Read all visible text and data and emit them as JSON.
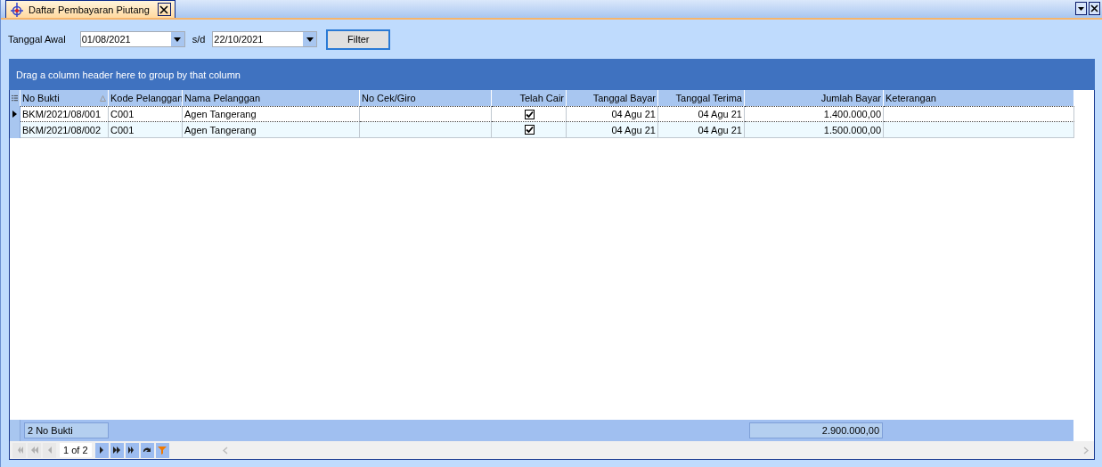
{
  "tab": {
    "title": "Daftar Pembayaran Piutang",
    "selected": true
  },
  "filter": {
    "label": "Tanggal Awal",
    "date_from": "01/08/2021",
    "separator": "s/d",
    "date_to": "22/10/2021",
    "button": "Filter"
  },
  "group_panel": "Drag a column header here to group by that column",
  "columns": [
    {
      "label": "No Bukti",
      "sorted": true
    },
    {
      "label": "Kode Pelanggan",
      "sorted": false
    },
    {
      "label": "Nama Pelanggan",
      "sorted": false
    },
    {
      "label": "No Cek/Giro",
      "sorted": false
    },
    {
      "label": "Telah Cair",
      "sorted": false
    },
    {
      "label": "Tanggal Bayar",
      "sorted": false
    },
    {
      "label": "Tanggal Terima",
      "sorted": false
    },
    {
      "label": "Jumlah Bayar",
      "sorted": false
    },
    {
      "label": "Keterangan",
      "sorted": false
    }
  ],
  "rows": [
    {
      "selected": true,
      "no_bukti": "BKM/2021/08/001",
      "kode": "C001",
      "nama": "Agen Tangerang",
      "telah_cair": true,
      "tanggal_bayar": "04 Agu 21",
      "tanggal_terima": "04 Agu 21",
      "jumlah": "1.400.000,00"
    },
    {
      "selected": false,
      "no_bukti": "BKM/2021/08/002",
      "kode": "C001",
      "nama": "Agen Tangerang",
      "telah_cair": true,
      "tanggal_bayar": "04 Agu 21",
      "tanggal_terima": "04 Agu 21",
      "jumlah": "1.500.000,00"
    }
  ],
  "footer": {
    "count": "2 No Bukti",
    "total": "2.900.000,00"
  },
  "navigator": {
    "page": "1 of 2",
    "buttons": [
      {
        "kind": "first",
        "disabled": true
      },
      {
        "kind": "prev-page",
        "disabled": true
      },
      {
        "kind": "prev",
        "disabled": true
      },
      {
        "kind": "next",
        "disabled": false
      },
      {
        "kind": "next-page",
        "disabled": false
      },
      {
        "kind": "last",
        "disabled": false
      },
      {
        "kind": "refresh",
        "disabled": false
      },
      {
        "kind": "filter",
        "disabled": false
      }
    ]
  }
}
